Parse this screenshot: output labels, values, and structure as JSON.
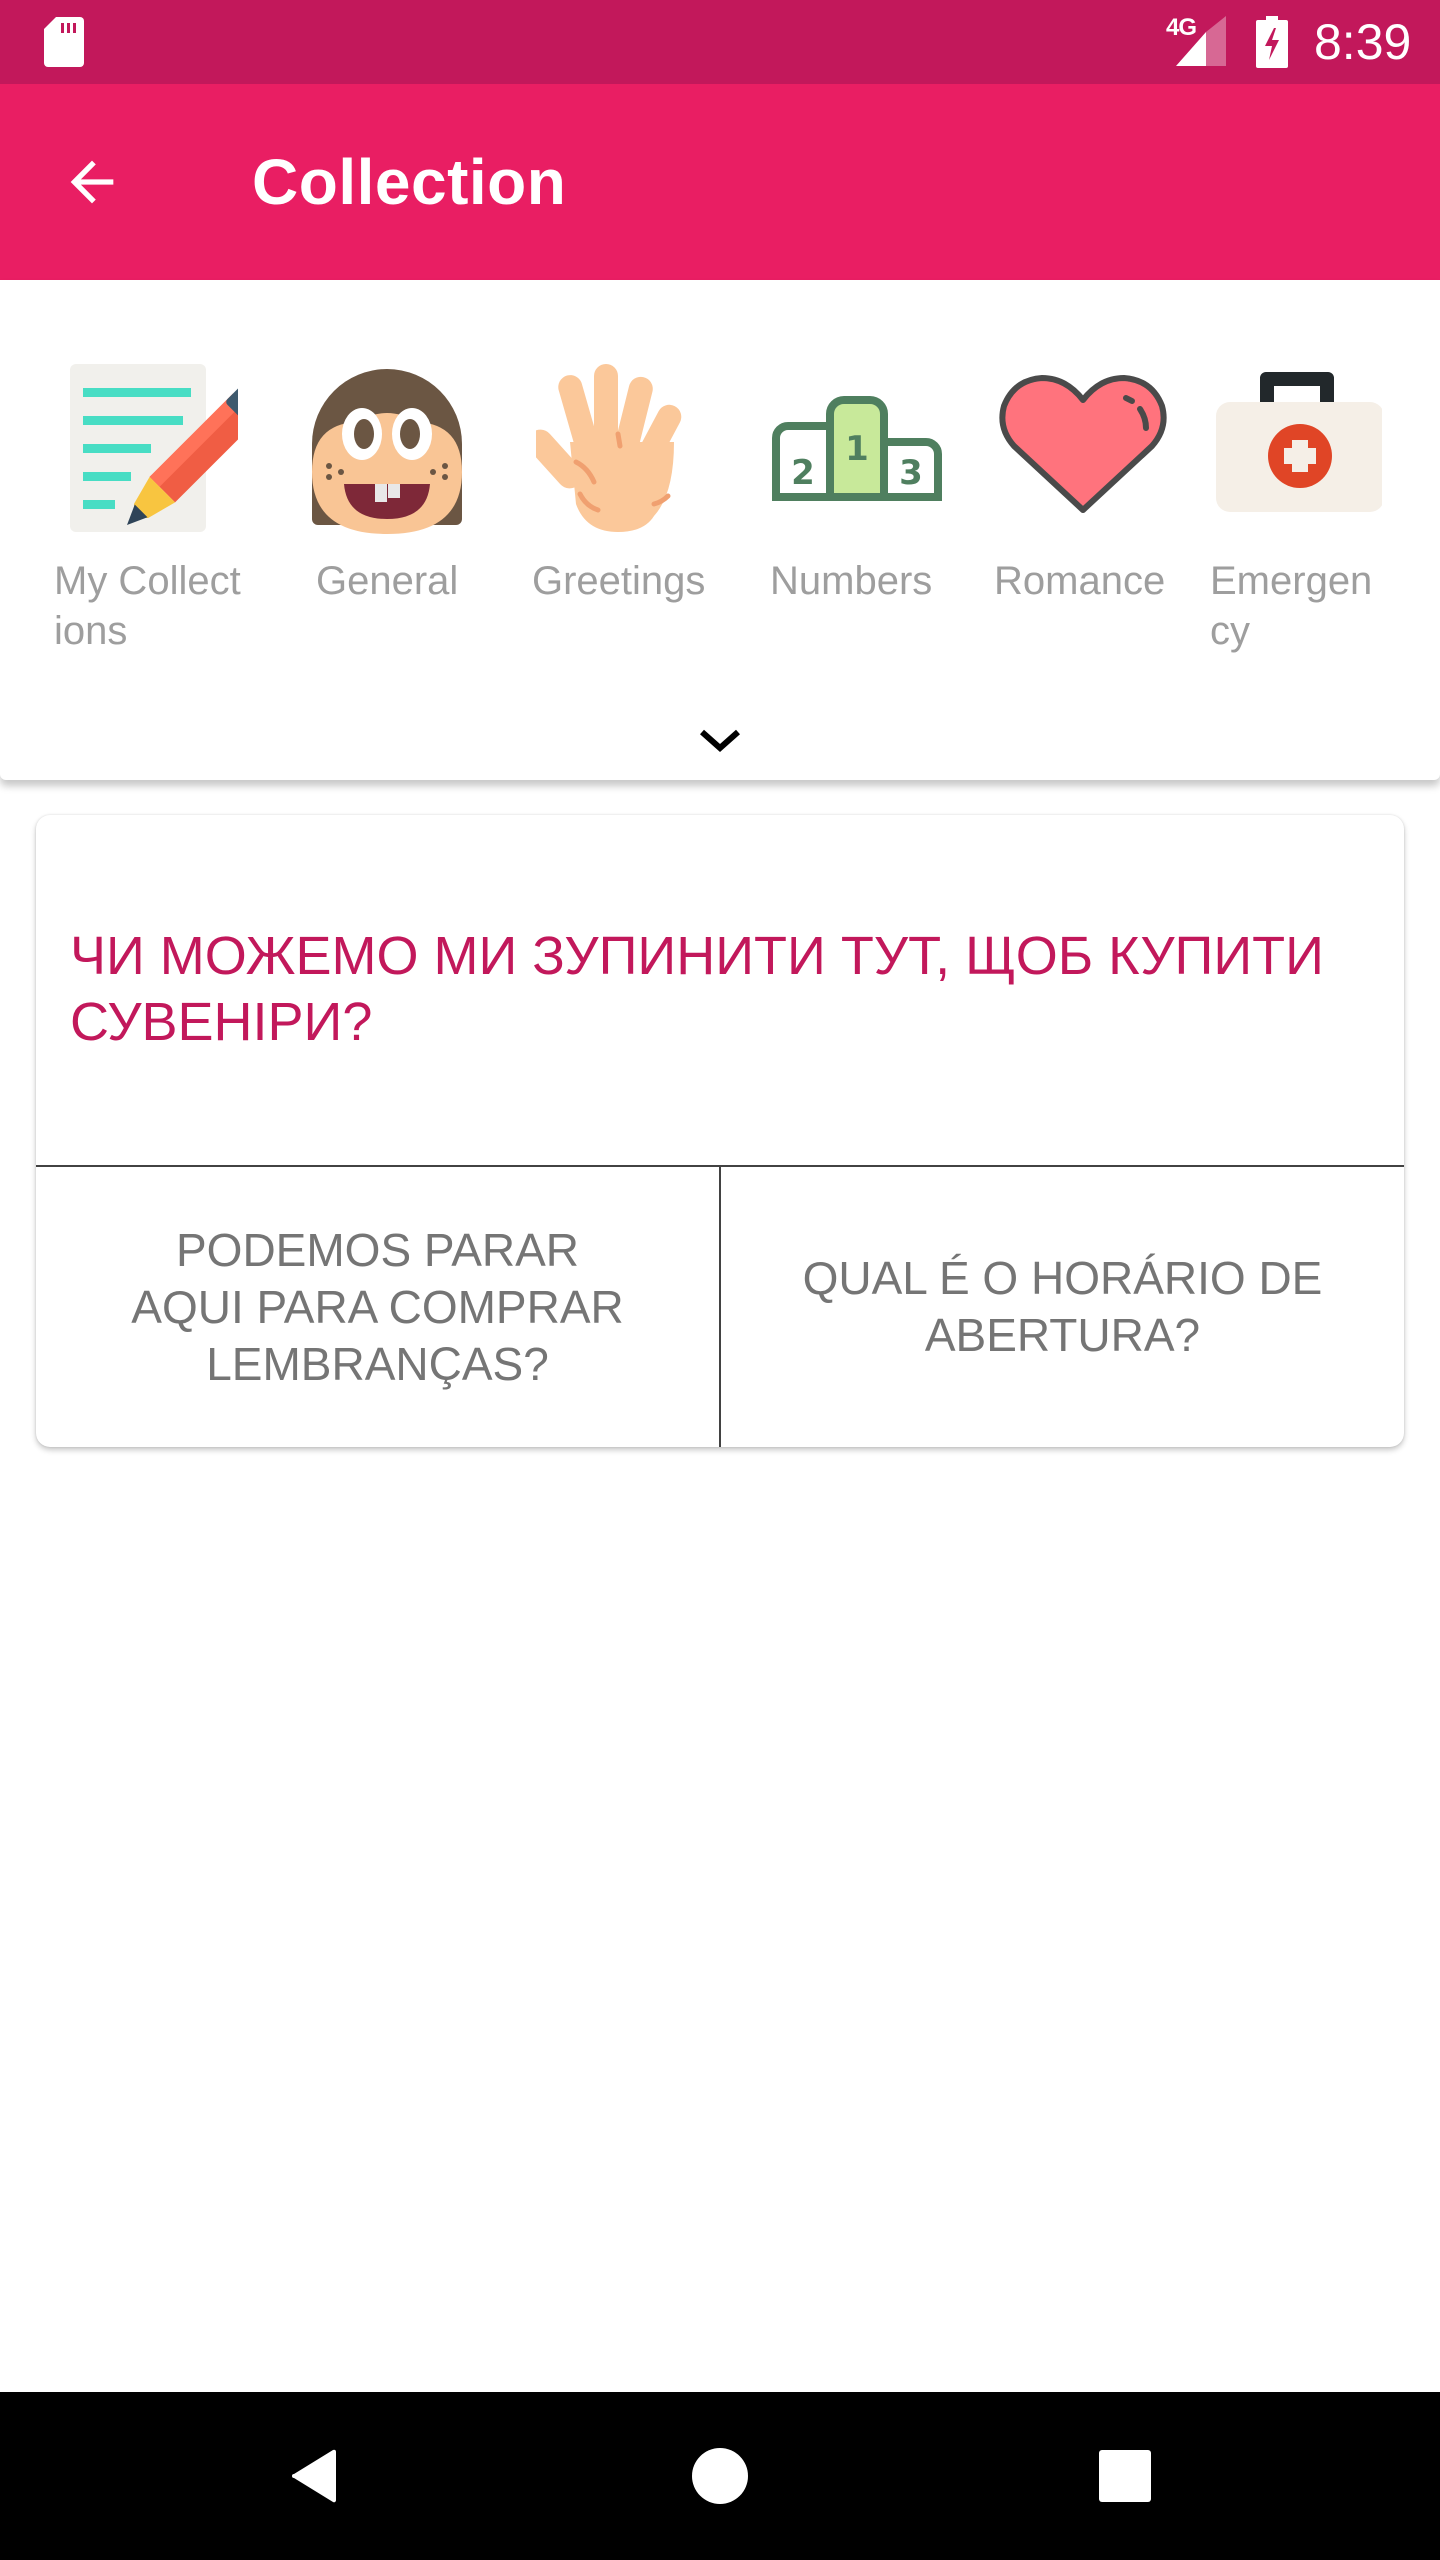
{
  "status_bar": {
    "network_label": "4G",
    "time": "8:39",
    "icons": [
      "sd-card-icon",
      "signal-icon",
      "battery-charging-icon"
    ]
  },
  "toolbar": {
    "title": "Collection",
    "back_icon": "arrow-back-icon"
  },
  "categories": {
    "items": [
      {
        "label": "My Collect\nions",
        "icon": "notepad-pencil-icon"
      },
      {
        "label": "General",
        "icon": "girl-face-icon"
      },
      {
        "label": "Greetings",
        "icon": "waving-hand-icon"
      },
      {
        "label": "Numbers",
        "icon": "podium-icon"
      },
      {
        "label": "Romance",
        "icon": "heart-icon"
      },
      {
        "label": "Emergen\ncy",
        "icon": "first-aid-kit-icon"
      }
    ],
    "expand_icon": "chevron-down-icon"
  },
  "card": {
    "question": "ЧИ МОЖЕМО МИ ЗУПИНИТИ ТУТ, ЩОБ КУПИТИ СУВЕНІРИ?",
    "answers": [
      "PODEMOS PARAR AQUI PARA COMPRAR LEMBRANÇAS?",
      "QUAL É O HORÁRIO DE ABERTURA?"
    ]
  },
  "nav_bar": {
    "buttons": [
      "back-triangle-icon",
      "home-circle-icon",
      "recents-square-icon"
    ]
  },
  "colors": {
    "status_bar": "#C2185B",
    "toolbar": "#E91E63",
    "question_text": "#C2185B",
    "answer_text": "#757575",
    "category_label": "#9E9E9E"
  }
}
